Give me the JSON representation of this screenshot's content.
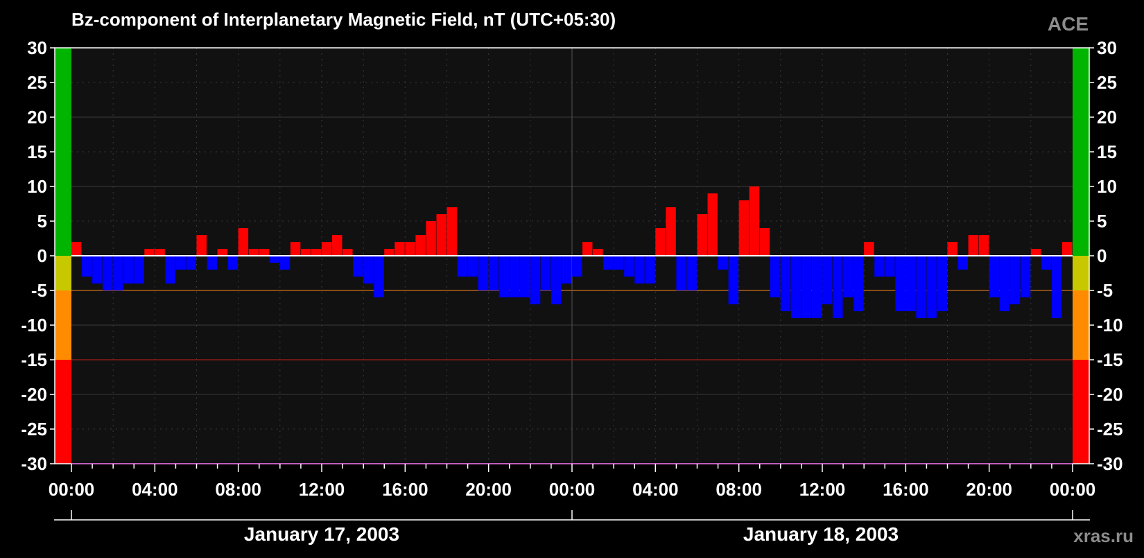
{
  "title": "Bz-component of Interplanetary Magnetic Field, nT (UTC+05:30)",
  "source_label": "ACE",
  "watermark": "xras.ru",
  "colors": {
    "background": "#000000",
    "plot_background": "#111111",
    "positive": "#ff0000",
    "negative": "#0000ff",
    "text": "#ffffff",
    "grid": "#3a3a3a",
    "zero_line": "#ffffff",
    "source_label": "#8c8c8c",
    "watermark": "#8c8c8c"
  },
  "scale_bands": [
    {
      "from": 0,
      "to": 30,
      "color": "#00b400"
    },
    {
      "from": -5,
      "to": 0,
      "color": "#c8c800"
    },
    {
      "from": -15,
      "to": -5,
      "color": "#ff8c00"
    },
    {
      "from": -30,
      "to": -15,
      "color": "#ff0000"
    }
  ],
  "threshold_lines": [
    {
      "value": -5,
      "color": "#b0601a"
    },
    {
      "value": -15,
      "color": "#8a1a1a"
    }
  ],
  "dates": [
    "January 17, 2003",
    "January 18, 2003"
  ],
  "chart_data": {
    "type": "bar",
    "ylim": [
      -30,
      30
    ],
    "yticks": [
      30,
      25,
      20,
      15,
      10,
      5,
      0,
      -5,
      -10,
      -15,
      -20,
      -25,
      -30
    ],
    "xlim_hours": [
      0,
      48
    ],
    "xtick_labels": [
      "00:00",
      "04:00",
      "08:00",
      "12:00",
      "16:00",
      "20:00",
      "00:00",
      "04:00",
      "08:00",
      "12:00",
      "16:00",
      "20:00",
      "00:00"
    ],
    "grid": true,
    "series": [
      {
        "x_hours": [
          0.0,
          0.5,
          1.0,
          1.5,
          2.0,
          2.5,
          3.0,
          3.5,
          4.0,
          4.5,
          5.0,
          5.5,
          6.0,
          6.5,
          7.0,
          7.5,
          8.0,
          8.5,
          9.0,
          9.5,
          10.0,
          10.5,
          11.0,
          11.5,
          12.0,
          12.5,
          13.0,
          13.5,
          14.0,
          14.5,
          15.0,
          15.5,
          16.0,
          16.5,
          17.0,
          17.5,
          18.0,
          18.5,
          19.0,
          19.5,
          20.0,
          20.5,
          21.0,
          21.5,
          22.0,
          22.5,
          23.0,
          23.5,
          24.0,
          24.5,
          25.0,
          25.5,
          26.0,
          26.5,
          27.0,
          27.5,
          28.0,
          28.5,
          29.0,
          29.5,
          30.0,
          30.5,
          31.0,
          31.5,
          32.0,
          32.5,
          33.0,
          33.5,
          34.0,
          34.5,
          35.0,
          35.5,
          36.0,
          36.5,
          37.0,
          37.5,
          38.0,
          38.5,
          39.0,
          39.5,
          40.0,
          40.5,
          41.0,
          41.5,
          42.0,
          42.5,
          43.0,
          43.5,
          44.0,
          44.5,
          45.0,
          45.5,
          46.0,
          46.5,
          47.0,
          47.5
        ],
        "values": [
          2,
          -3,
          -4,
          -5,
          -5,
          -4,
          -4,
          1,
          1,
          -4,
          -2,
          -2,
          3,
          -2,
          1,
          -2,
          4,
          1,
          1,
          -1,
          -2,
          2,
          1,
          1,
          2,
          3,
          1,
          -3,
          -4,
          -6,
          1,
          2,
          2,
          3,
          5,
          6,
          7,
          -3,
          -3,
          -5,
          -5,
          -6,
          -6,
          -6,
          -7,
          -5,
          -7,
          -4,
          -3,
          2,
          1,
          -2,
          -2,
          -3,
          -4,
          -4,
          4,
          7,
          -5,
          -5,
          6,
          9,
          -2,
          -7,
          8,
          10,
          4,
          -6,
          -8,
          -9,
          -9,
          -9,
          -7,
          -9,
          -6,
          -8,
          2,
          -3,
          -3,
          -8,
          -8,
          -9,
          -9,
          -8,
          2,
          -2,
          3,
          3,
          -6,
          -8,
          -7,
          -6,
          1,
          -2,
          -9,
          2
        ]
      }
    ]
  }
}
